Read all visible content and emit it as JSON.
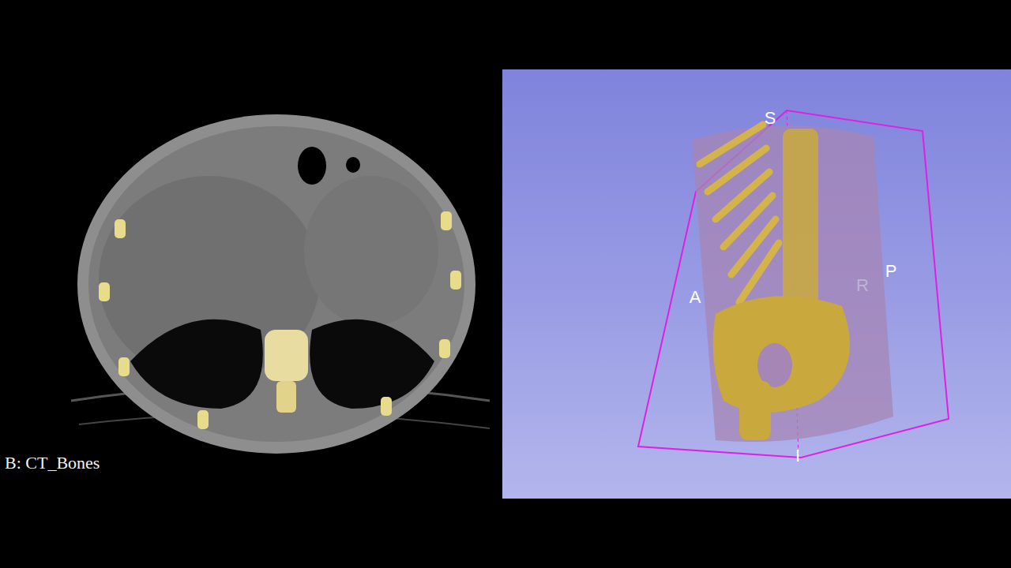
{
  "slice_view": {
    "label": "B: CT_Bones"
  },
  "three_d_view": {
    "orientation_markers": [
      {
        "label": "S",
        "dimmed": false
      },
      {
        "label": "A",
        "dimmed": false
      },
      {
        "label": "P",
        "dimmed": false
      },
      {
        "label": "R",
        "dimmed": true
      },
      {
        "label": "I",
        "dimmed": false
      }
    ]
  }
}
